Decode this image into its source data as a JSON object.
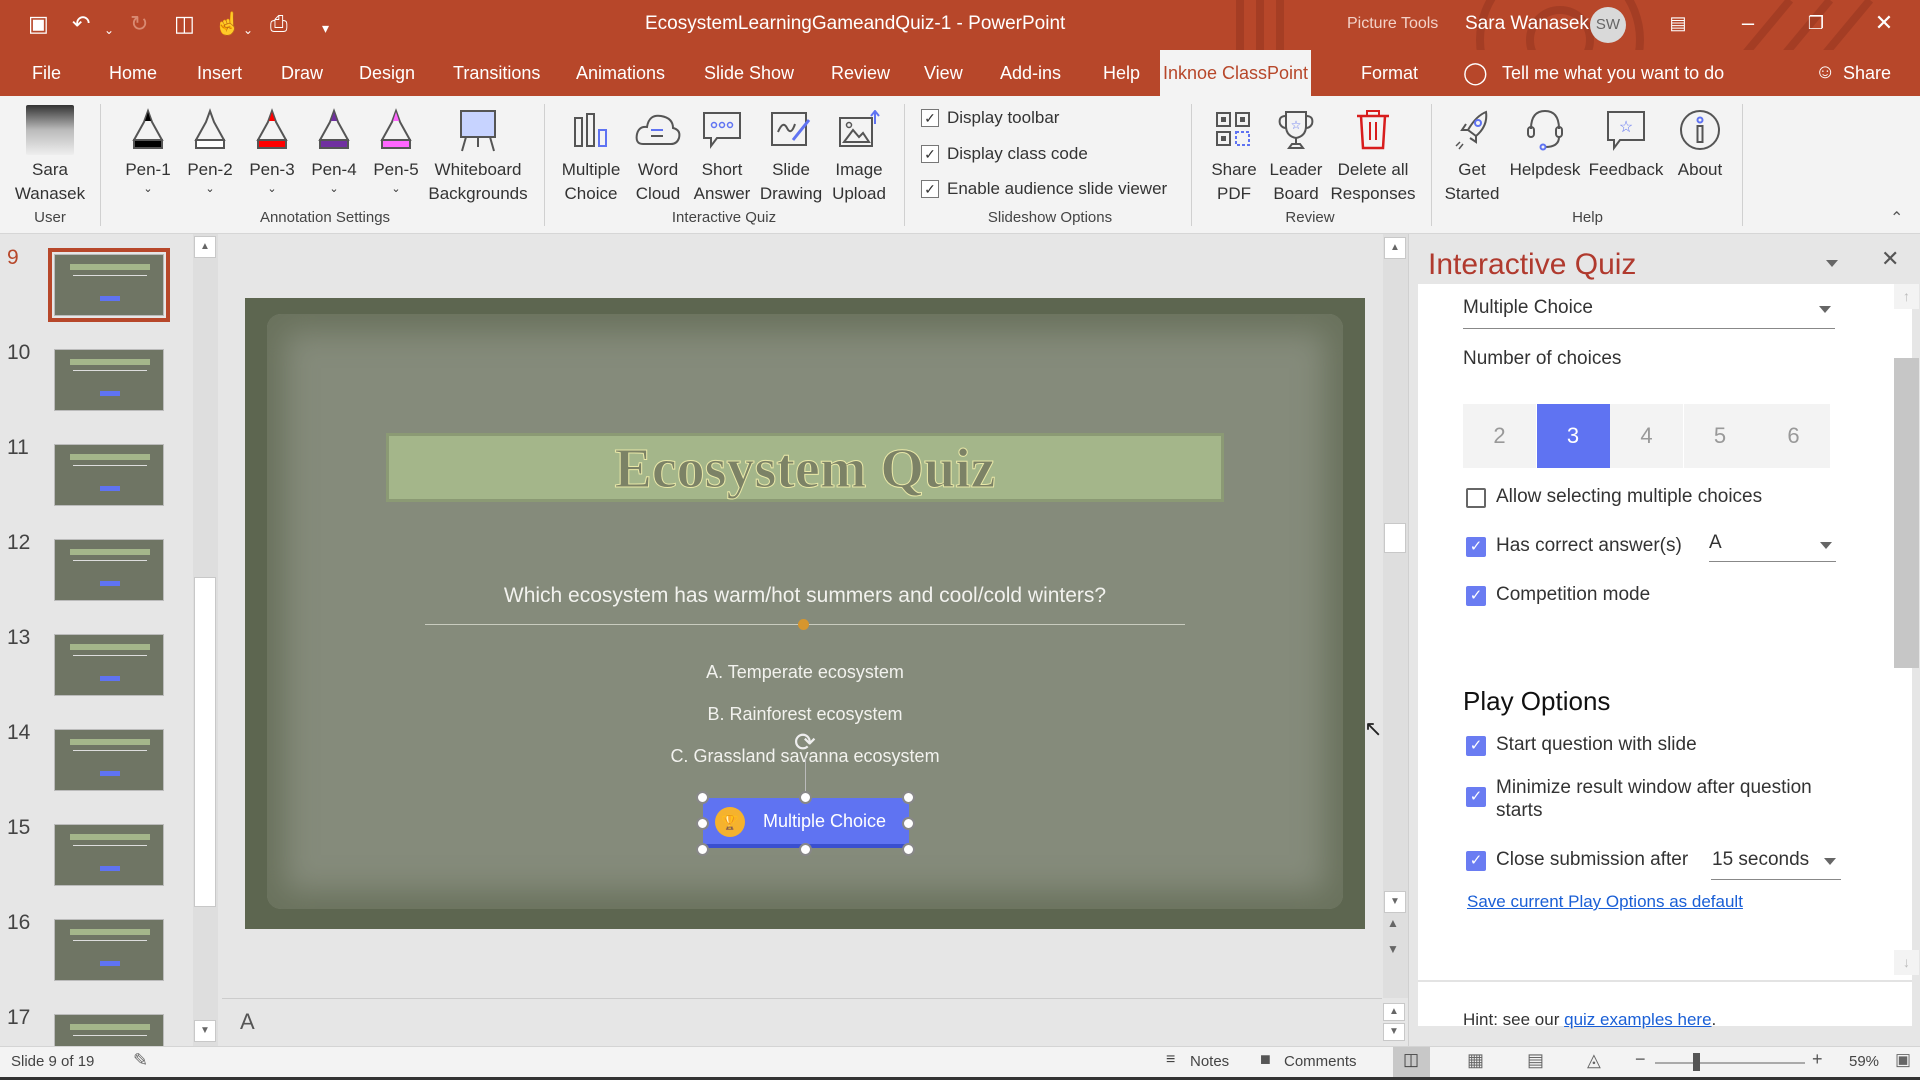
{
  "app": {
    "document_title": "EcosystemLearningGameandQuiz-1  -  PowerPoint",
    "context_label": "Picture Tools",
    "user_name": "Sara Wanasek",
    "user_initials": "SW"
  },
  "quick_access": [
    {
      "name": "save-icon",
      "glyph": "🖫"
    },
    {
      "name": "undo-icon",
      "glyph": "↶"
    },
    {
      "name": "redo-icon",
      "glyph": "↻"
    },
    {
      "name": "presenter-icon",
      "glyph": "▣"
    },
    {
      "name": "touch-mode-icon",
      "glyph": "☝"
    },
    {
      "name": "print-icon",
      "glyph": "⎙"
    },
    {
      "name": "customize-icon",
      "glyph": "⩡"
    }
  ],
  "tabs": [
    "File",
    "Home",
    "Insert",
    "Draw",
    "Design",
    "Transitions",
    "Animations",
    "Slide Show",
    "Review",
    "View",
    "Add-ins",
    "Help",
    "Inknoe ClassPoint",
    "Format"
  ],
  "active_tab": "Inknoe ClassPoint",
  "tell_me": "Tell me what you want to do",
  "share_label": "Share",
  "ribbon": {
    "user": {
      "name_line1": "Sara",
      "name_line2": "Wanasek",
      "group": "User"
    },
    "annotation": {
      "group": "Annotation Settings",
      "pens": [
        {
          "label": "Pen-1",
          "color": "#000000"
        },
        {
          "label": "Pen-2",
          "color": "#ffffff"
        },
        {
          "label": "Pen-3",
          "color": "#ff0000"
        },
        {
          "label": "Pen-4",
          "color": "#7030a0"
        },
        {
          "label": "Pen-5",
          "color": "#ff66ff"
        }
      ],
      "whiteboard_line1": "Whiteboard",
      "whiteboard_line2": "Backgrounds"
    },
    "quiz": {
      "group": "Interactive Quiz",
      "buttons": [
        {
          "l1": "Multiple",
          "l2": "Choice"
        },
        {
          "l1": "Word",
          "l2": "Cloud"
        },
        {
          "l1": "Short",
          "l2": "Answer"
        },
        {
          "l1": "Slide",
          "l2": "Drawing"
        },
        {
          "l1": "Image",
          "l2": "Upload"
        }
      ]
    },
    "slideshow": {
      "group": "Slideshow Options",
      "options": [
        {
          "label": "Display toolbar",
          "checked": true
        },
        {
          "label": "Display class code",
          "checked": true
        },
        {
          "label": "Enable audience slide viewer",
          "checked": true
        }
      ]
    },
    "review": {
      "group": "Review",
      "buttons": [
        {
          "l1": "Share",
          "l2": "PDF"
        },
        {
          "l1": "Leader",
          "l2": "Board"
        },
        {
          "l1": "Delete all",
          "l2": "Responses"
        }
      ]
    },
    "help": {
      "group": "Help",
      "buttons": [
        {
          "l1": "Get",
          "l2": "Started"
        },
        {
          "l1": "Helpdesk",
          "l2": ""
        },
        {
          "l1": "Feedback",
          "l2": ""
        },
        {
          "l1": "About",
          "l2": ""
        }
      ]
    }
  },
  "thumbnails": [
    {
      "num": "9",
      "selected": true
    },
    {
      "num": "10"
    },
    {
      "num": "11"
    },
    {
      "num": "12"
    },
    {
      "num": "13"
    },
    {
      "num": "14"
    },
    {
      "num": "15"
    },
    {
      "num": "16"
    },
    {
      "num": "17"
    }
  ],
  "slide": {
    "title": "Ecosystem Quiz",
    "question": "Which ecosystem has warm/hot summers and cool/cold winters?",
    "options": [
      "A. Temperate ecosystem",
      "B. Rainforest ecosystem",
      "C. Grassland savanna ecosystem"
    ],
    "button_label": "Multiple Choice"
  },
  "notes_text": "A",
  "panel": {
    "title": "Interactive Quiz",
    "quiz_type": "Multiple Choice",
    "num_choices_label": "Number of choices",
    "choices": [
      "2",
      "3",
      "4",
      "5",
      "6"
    ],
    "selected_choice": "3",
    "allow_multiple": {
      "label": "Allow selecting multiple choices",
      "checked": false
    },
    "has_correct": {
      "label": "Has correct answer(s)",
      "checked": true,
      "value": "A"
    },
    "competition": {
      "label": "Competition mode",
      "checked": true
    },
    "play_options_heading": "Play Options",
    "start_with_slide": {
      "label": "Start question with slide",
      "checked": true
    },
    "minimize": {
      "label1": "Minimize result window after question",
      "label2": "starts",
      "checked": true
    },
    "close_submission": {
      "label": "Close submission after",
      "checked": true,
      "value": "15 seconds"
    },
    "save_default_link": "Save current Play Options as default",
    "hint_prefix": "Hint: see our ",
    "hint_link": "quiz examples here",
    "hint_suffix": "."
  },
  "status": {
    "slide_info": "Slide 9 of 19",
    "notes": "Notes",
    "comments": "Comments",
    "zoom": "59%",
    "zoom_fraction": 0.59
  },
  "colors": {
    "brand": "#b7472a",
    "accent": "#5f73f2",
    "trophy": "#f5b22e",
    "panel_title": "#b03a2e",
    "link": "#1a5fd6"
  }
}
